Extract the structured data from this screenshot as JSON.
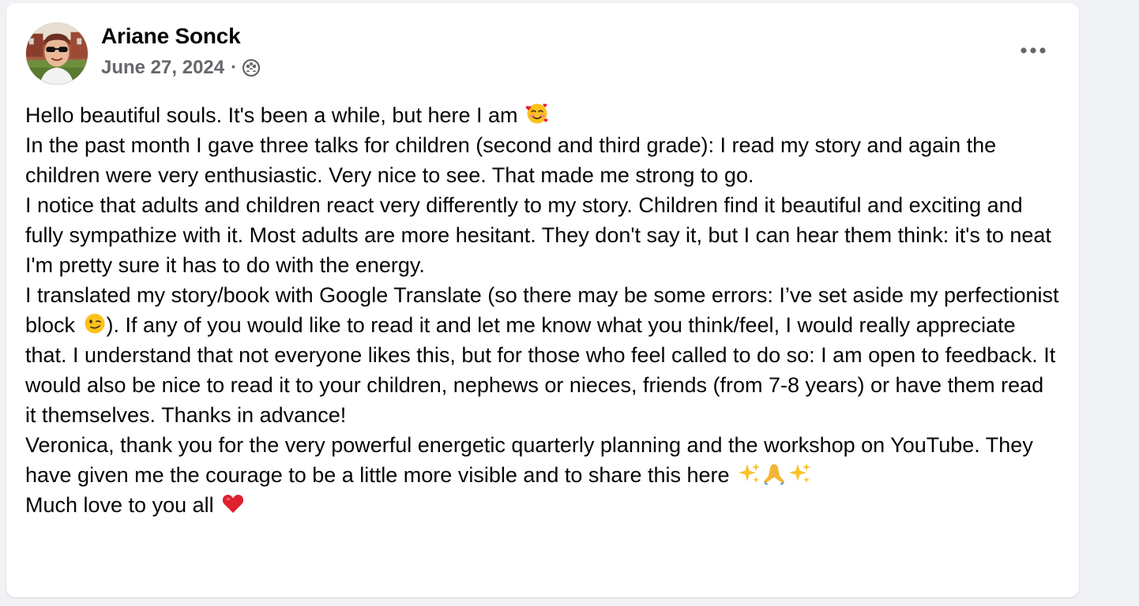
{
  "post": {
    "author": "Ariane Sonck",
    "date": "June 27, 2024",
    "separator": "·",
    "audience_icon": "group-icon",
    "more_icon": "more-options-icon",
    "paragraphs": [
      {
        "text": "Hello beautiful souls. It's been a while, but here I am ",
        "emoji_after": "smiling-face-with-hearts"
      },
      {
        "text": "In the past month I gave three talks for children (second and third grade): I read my story and again the children were very enthusiastic. Very nice to see. That made me strong to go."
      },
      {
        "text": "I notice that adults and children react very differently to my story. Children find it beautiful and exciting and fully sympathize with it. Most adults are more hesitant. They don't say it, but I can hear them think: it's to neat  I'm pretty sure it has to do with the energy."
      },
      {
        "text_before": "I translated my story/book with Google Translate (so there may be some errors: I’ve set aside my perfectionist block ",
        "emoji": "winking-face",
        "text_after": "). If any of you would like to read it and let me know what you think/feel, I would really appreciate that. I understand that not everyone likes this, but for those who feel called to do so: I am open to feedback. It would also be nice to read it to your children, nephews or nieces, friends (from 7-8 years) or have them read it themselves. Thanks in advance!"
      },
      {
        "text": "Veronica, thank you for the very powerful energetic quarterly planning and the workshop on YouTube. They have given me the courage to be a little more visible and to share this here ",
        "emojis_after": [
          "sparkles",
          "folded-hands",
          "sparkles"
        ]
      },
      {
        "text": "Much love to you all ",
        "emoji_after": "red-heart"
      }
    ]
  },
  "colors": {
    "background": "#f0f2f5",
    "card": "#ffffff",
    "primary_text": "#050505",
    "secondary_text": "#65676b",
    "heart": "#e0202e",
    "sparkle": "#f7c32e",
    "hands": "#f5b632"
  }
}
